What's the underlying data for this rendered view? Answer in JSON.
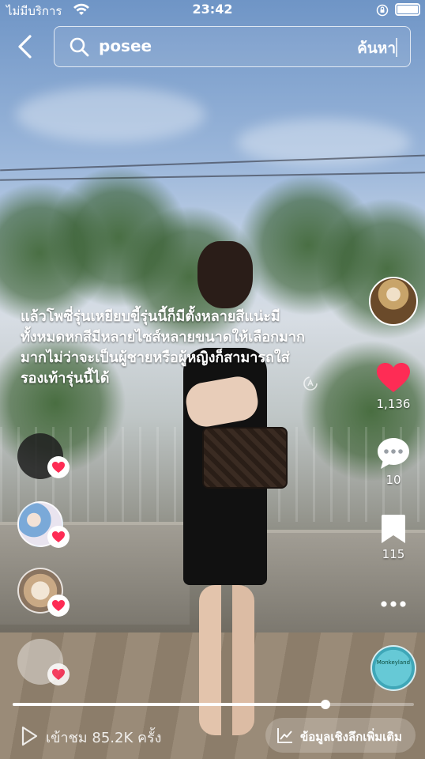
{
  "status_bar": {
    "carrier": "ไม่มีบริการ",
    "time": "23:42"
  },
  "header": {
    "back_icon": "chevron-left-icon",
    "search_icon": "search-icon",
    "search_query": "posee",
    "search_button": "ค้นหา"
  },
  "video": {
    "caption": "แล้วโพซี่รุ่นเหยียบขี้รุ่นนี้ก็มีตั้งหลายสีแน่ะมีทั้งหมดหกสีมีหลายไซส์หลายขนาดให้เลือกมากมากไม่ว่าจะเป็นผู้ชายหรือผู้หญิงก็สามารถใส่รองเท้ารุ่นนี้ได้",
    "progress": 0.78
  },
  "actions": {
    "likes": "1,136",
    "comments": "10",
    "saves": "115"
  },
  "sound_disc": {
    "text": "Monkeyland"
  },
  "footer": {
    "views": "เข้าชม 85.2K ครั้ง",
    "insights_button": "ข้อมูลเชิงลึกเพิ่มเติม"
  },
  "colors": {
    "like_red": "#fe2c55",
    "accent_white": "#ffffff"
  }
}
